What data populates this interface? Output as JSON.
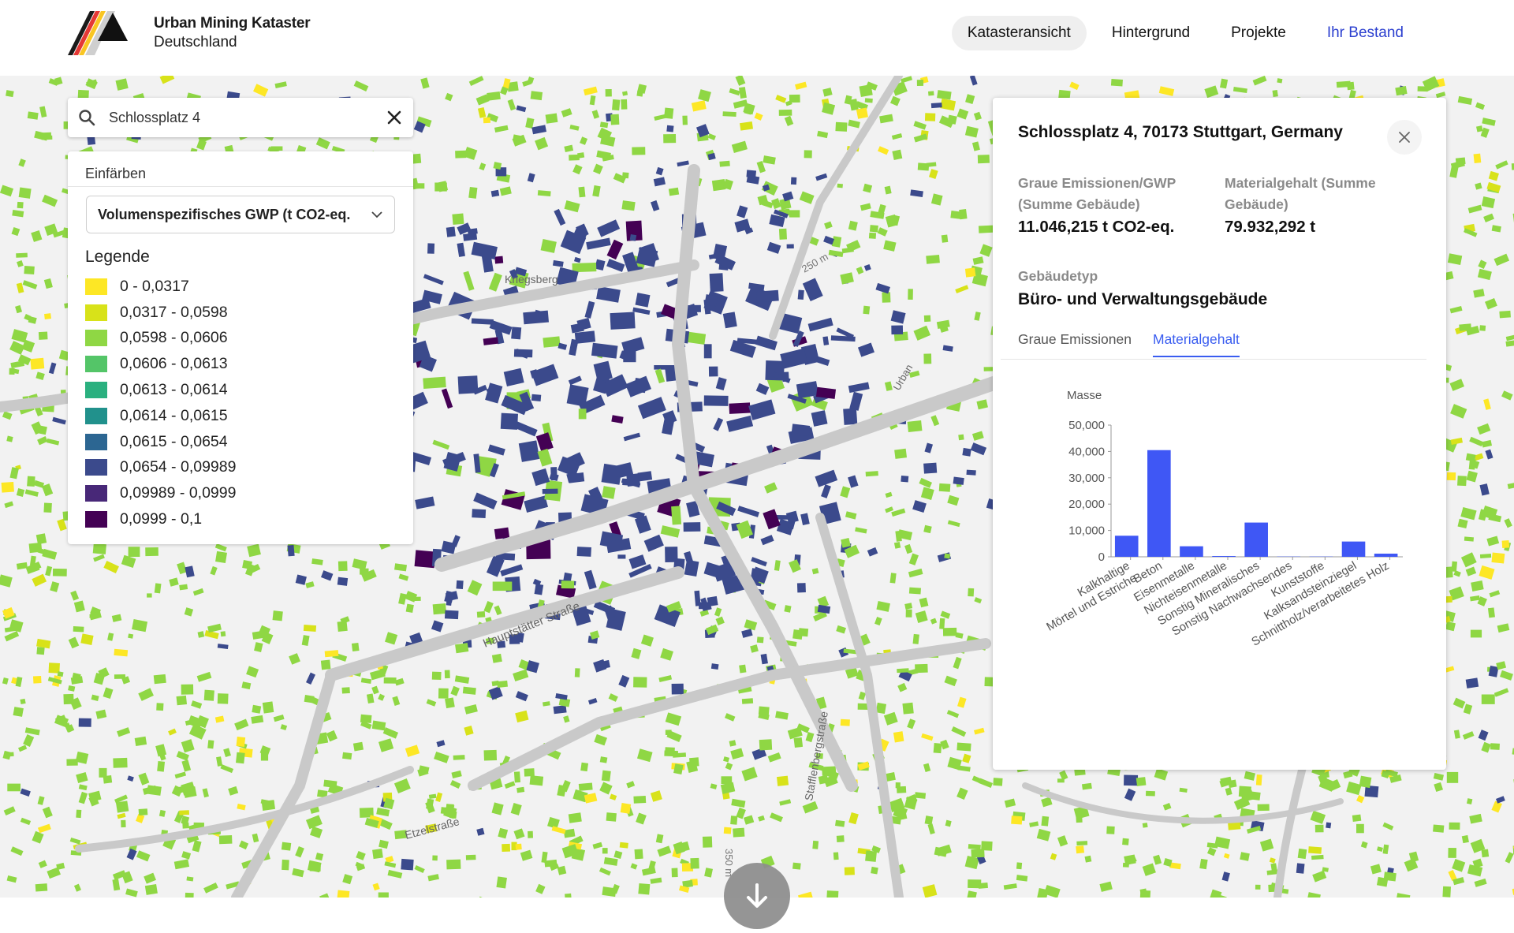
{
  "header": {
    "brand_line1": "Urban Mining Kataster",
    "brand_line2": "Deutschland",
    "nav": [
      {
        "label": "Katasteransicht",
        "active": true
      },
      {
        "label": "Hintergrund"
      },
      {
        "label": "Projekte"
      },
      {
        "label": "Ihr Bestand",
        "accent": true
      }
    ]
  },
  "search": {
    "value": "Schlossplatz 4"
  },
  "coloring": {
    "title": "Einfärben",
    "selected": "Volumenspezifisches GWP (t CO2-eq.",
    "legend_title": "Legende",
    "legend": [
      {
        "label": "0 - 0,0317",
        "color": "#fde725"
      },
      {
        "label": "0,0317 - 0,0598",
        "color": "#d8e219"
      },
      {
        "label": "0,0598 - 0,0606",
        "color": "#8fd744"
      },
      {
        "label": "0,0606 - 0,0613",
        "color": "#54c568"
      },
      {
        "label": "0,0613 - 0,0614",
        "color": "#2ab07f"
      },
      {
        "label": "0,0614 - 0,0615",
        "color": "#21918c"
      },
      {
        "label": "0,0615 - 0,0654",
        "color": "#2c6692"
      },
      {
        "label": "0,0654 - 0,09989",
        "color": "#3b4a8c"
      },
      {
        "label": "0,09989 - 0,0999",
        "color": "#482878"
      },
      {
        "label": "0,0999 - 0,1",
        "color": "#440154"
      }
    ]
  },
  "map_labels": {
    "street1": "Hauptstätter Straße",
    "street2": "Kriegsberg",
    "street3": "Stafflenbergstraße",
    "street4": "Etzelstraße",
    "street5": "Urban",
    "dist1": "250 m",
    "dist2": "350 m"
  },
  "info": {
    "address": "Schlossplatz 4, 70173 Stuttgart, Germany",
    "stat1_label": "Graue Emissionen/GWP (Summe Gebäude)",
    "stat1_value": "11.046,215 t CO2-eq.",
    "stat2_label": "Materialgehalt (Summe Gebäude)",
    "stat2_value": "79.932,292 t",
    "type_label": "Gebäudetyp",
    "type_value": "Büro- und Verwaltungsgebäude",
    "tabs": [
      {
        "label": "Graue Emissionen"
      },
      {
        "label": "Materialgehalt",
        "active": true
      }
    ]
  },
  "chart_data": {
    "type": "bar",
    "ylabel": "Masse",
    "ylim": [
      0,
      50000
    ],
    "yticks": [
      "0",
      "10,000",
      "20,000",
      "30,000",
      "40,000",
      "50,000"
    ],
    "bar_color": "#3f57f5",
    "categories": [
      "Kalkhaltige Mörtel und Estriche",
      "Beton",
      "Eisenmetalle",
      "Nichteisenmetalle",
      "Sonstig Mineralisches",
      "Sonstig Nachwachsendes",
      "Kunststoffe",
      "Kalksandsteinziegel",
      "Schnittholz/verarbeitetes Holz"
    ],
    "values": [
      8000,
      40500,
      4000,
      300,
      13000,
      100,
      100,
      5800,
      1200
    ]
  }
}
